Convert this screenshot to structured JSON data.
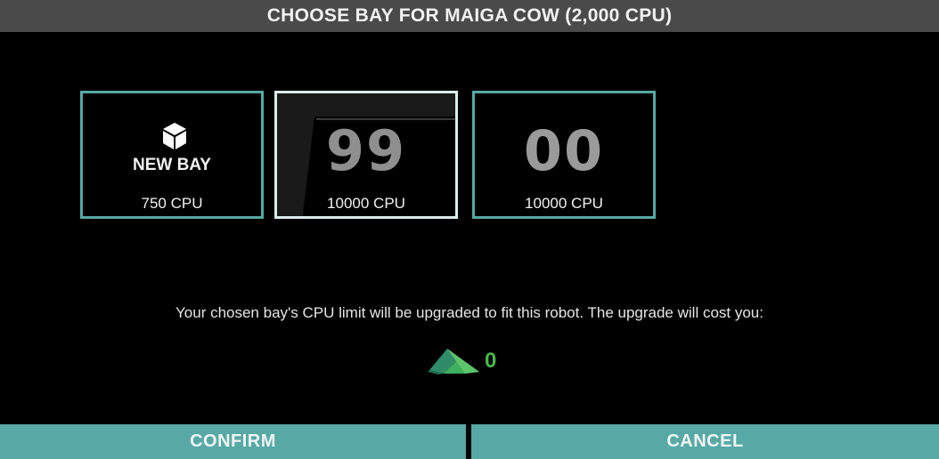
{
  "header": {
    "title": "CHOOSE BAY FOR MAIGA COW (2,000 CPU)"
  },
  "bays": [
    {
      "type": "new",
      "label": "NEW BAY",
      "cpu": "750 CPU",
      "icon": "cube-icon"
    },
    {
      "type": "existing",
      "number": "99",
      "cpu": "10000 CPU",
      "selected": true
    },
    {
      "type": "existing",
      "number": "00",
      "cpu": "10000 CPU",
      "selected": false
    }
  ],
  "upgrade": {
    "message": "Your chosen bay's CPU limit will be upgraded to fit this robot. The upgrade will cost you:",
    "cost": "0",
    "icon": "robits-currency-icon",
    "cost_color": "#49b94a"
  },
  "footer": {
    "confirm_label": "CONFIRM",
    "cancel_label": "CANCEL"
  },
  "colors": {
    "accent": "#56a9a5",
    "header_bg": "#4a4a4a",
    "selected_border": "#d8eeec"
  }
}
